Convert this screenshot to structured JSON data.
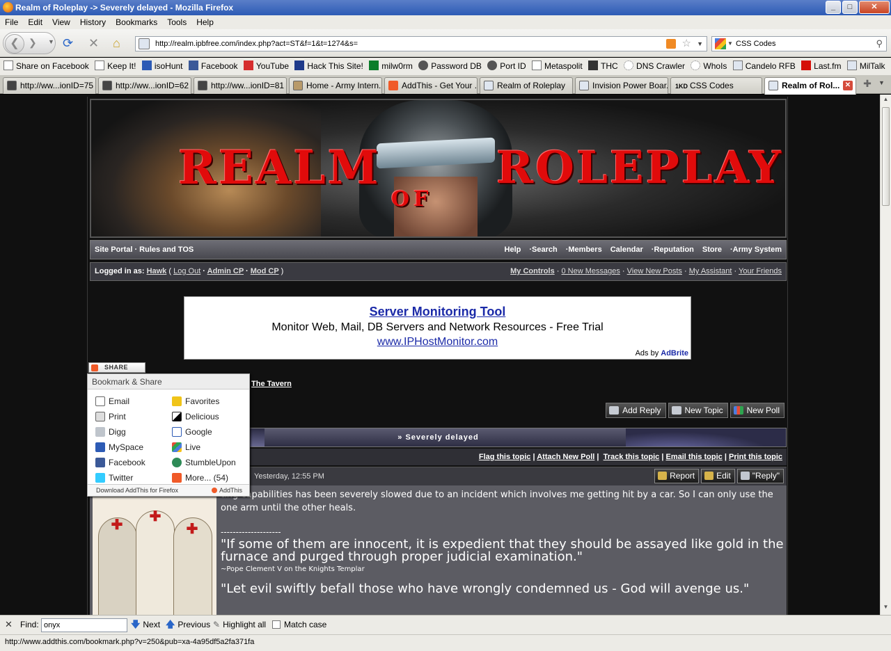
{
  "window": {
    "title": "Realm of Roleplay -> Severely delayed - Mozilla Firefox",
    "controls": [
      "_",
      "□",
      "✕"
    ]
  },
  "menu": [
    "File",
    "Edit",
    "View",
    "History",
    "Bookmarks",
    "Tools",
    "Help"
  ],
  "nav": {
    "url": "http://realm.ipbfree.com/index.php?act=ST&f=1&t=1274&s=",
    "search_engine_value": "CSS Codes"
  },
  "bookmarks": [
    "Share on Facebook",
    "Keep It!",
    "isoHunt",
    "Facebook",
    "YouTube",
    "Hack This Site!",
    "milw0rm",
    "Password DB",
    "Port ID",
    "Metaspolit",
    "THC",
    "DNS Crawler",
    "WhoIs",
    "Candelo RFB",
    "Last.fm",
    "MilTalk"
  ],
  "tabs": [
    {
      "label": "http://ww...ionID=75"
    },
    {
      "label": "http://ww...ionID=62"
    },
    {
      "label": "http://ww...ionID=81"
    },
    {
      "label": "Home - Army Intern..."
    },
    {
      "label": "AddThis - Get Your ..."
    },
    {
      "label": "Realm of Roleplay"
    },
    {
      "label": "Invision Power Boar..."
    },
    {
      "label": "CSS Codes"
    },
    {
      "label": "Realm of Rol..."
    }
  ],
  "tab_extra": {
    "css_codes_prefix": "1KD"
  },
  "forum": {
    "banner": {
      "word1": "REALM",
      "word2": "OF",
      "word3": "ROLEPLAY"
    },
    "nav_left": "Site Portal · Rules and TOS",
    "nav_right": [
      "Help",
      "·Search",
      "·Members",
      "Calendar",
      "·Reputation",
      "Store",
      "·Army System"
    ],
    "login": {
      "prefix": "Logged in as:",
      "user": "Hawk",
      "links": [
        "Log Out",
        "Admin CP",
        "Mod CP"
      ],
      "right_links": [
        "My Controls",
        "0 New Messages",
        "View New Posts",
        "My Assistant",
        "Your Friends"
      ]
    },
    "ad": {
      "title": "Server Monitoring Tool",
      "line2": "Monitor Web, Mail, DB Servers and Network Resources - Free Trial",
      "link": "www.IPHostMonitor.com",
      "by_prefix": "Ads by",
      "by_brand": "AdBrite"
    },
    "breadcrumb": "The Tavern",
    "action_buttons": [
      "Add Reply",
      "New Topic",
      "New Poll"
    ],
    "topic_title": "» Severely delayed",
    "topic_options": [
      "Flag this topic",
      "Attach New Poll",
      "Track this topic",
      "Email this topic",
      "Print this topic"
    ],
    "post": {
      "date": "Yesterday, 12:55 PM",
      "buttons": [
        "Report",
        "Edit",
        "\"Reply\""
      ],
      "body": "ting capabilities has been severely slowed due to an incident which involves me getting hit by a car. So I can only use the one arm until the other heals.",
      "separator": "--------------------",
      "quote1": "\"If some of them are innocent, it is expedient that they should be assayed like gold in the furnace and purged through proper judicial examination.\"",
      "quote1_source": "~Pope Clement V on the Knights Templar",
      "quote2": "\"Let evil swiftly befall those who have wrongly condemned us - God will avenge us.\""
    }
  },
  "addthis": {
    "share_button": "SHARE",
    "header": "Bookmark & Share",
    "items_left": [
      "Email",
      "Print",
      "Digg",
      "MySpace",
      "Facebook",
      "Twitter"
    ],
    "items_right": [
      "Favorites",
      "Delicious",
      "Google",
      "Live",
      "StumbleUpon",
      "More... (54)"
    ],
    "footer_left": "Download AddThis for Firefox",
    "footer_right": "AddThis"
  },
  "findbar": {
    "label": "Find:",
    "value": "onyx",
    "next": "Next",
    "previous": "Previous",
    "highlight": "Highlight all",
    "match_case": "Match case"
  },
  "status": "http://www.addthis.com/bookmark.php?v=250&pub=xa-4a95df5a2fa371fa"
}
